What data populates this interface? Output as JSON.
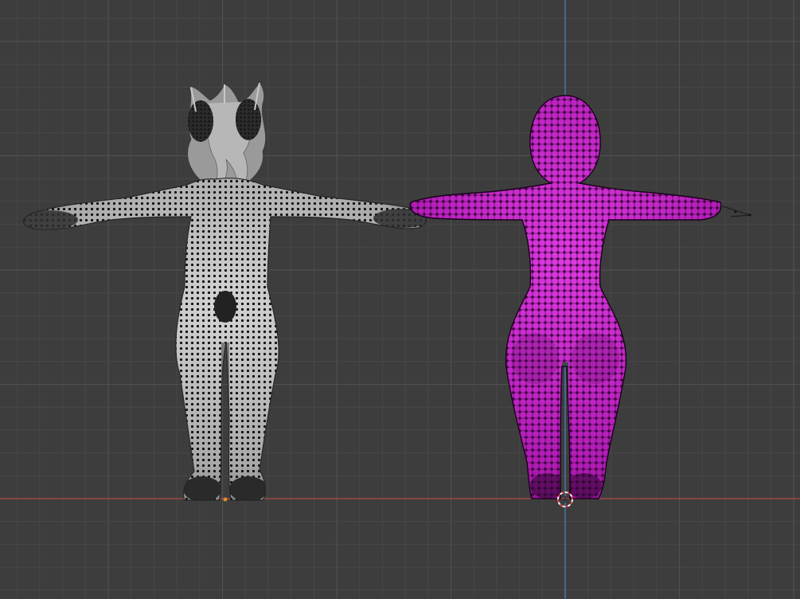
{
  "viewport": {
    "mode": "orthographic-front",
    "grid": true,
    "colors": {
      "background": "#3d3d3d",
      "grid_minor": "#484848",
      "grid_major": "#525252",
      "x_axis": "#b34a4a",
      "z_axis": "#4d7db8",
      "inactive_mesh": "#b9b9b9",
      "inactive_mesh_dark": "#7d7d7d",
      "selected_mesh": "#b21ab6",
      "selected_mesh_light": "#d22fd6",
      "vertex": "#111111",
      "origin_dot": "#e08a2c",
      "cursor_red": "#e03a3a",
      "cursor_white": "#f0f0f0"
    }
  },
  "objects": [
    {
      "id": "textured-character",
      "selected": false,
      "shading": "solid-grey",
      "icon": "hair-ears-detail"
    },
    {
      "id": "retopology-character",
      "selected": true,
      "shading": "selection-highlight"
    }
  ],
  "overlays": {
    "cursor_icon": "3d-cursor-icon",
    "origin_icon": "object-origin-icon"
  }
}
